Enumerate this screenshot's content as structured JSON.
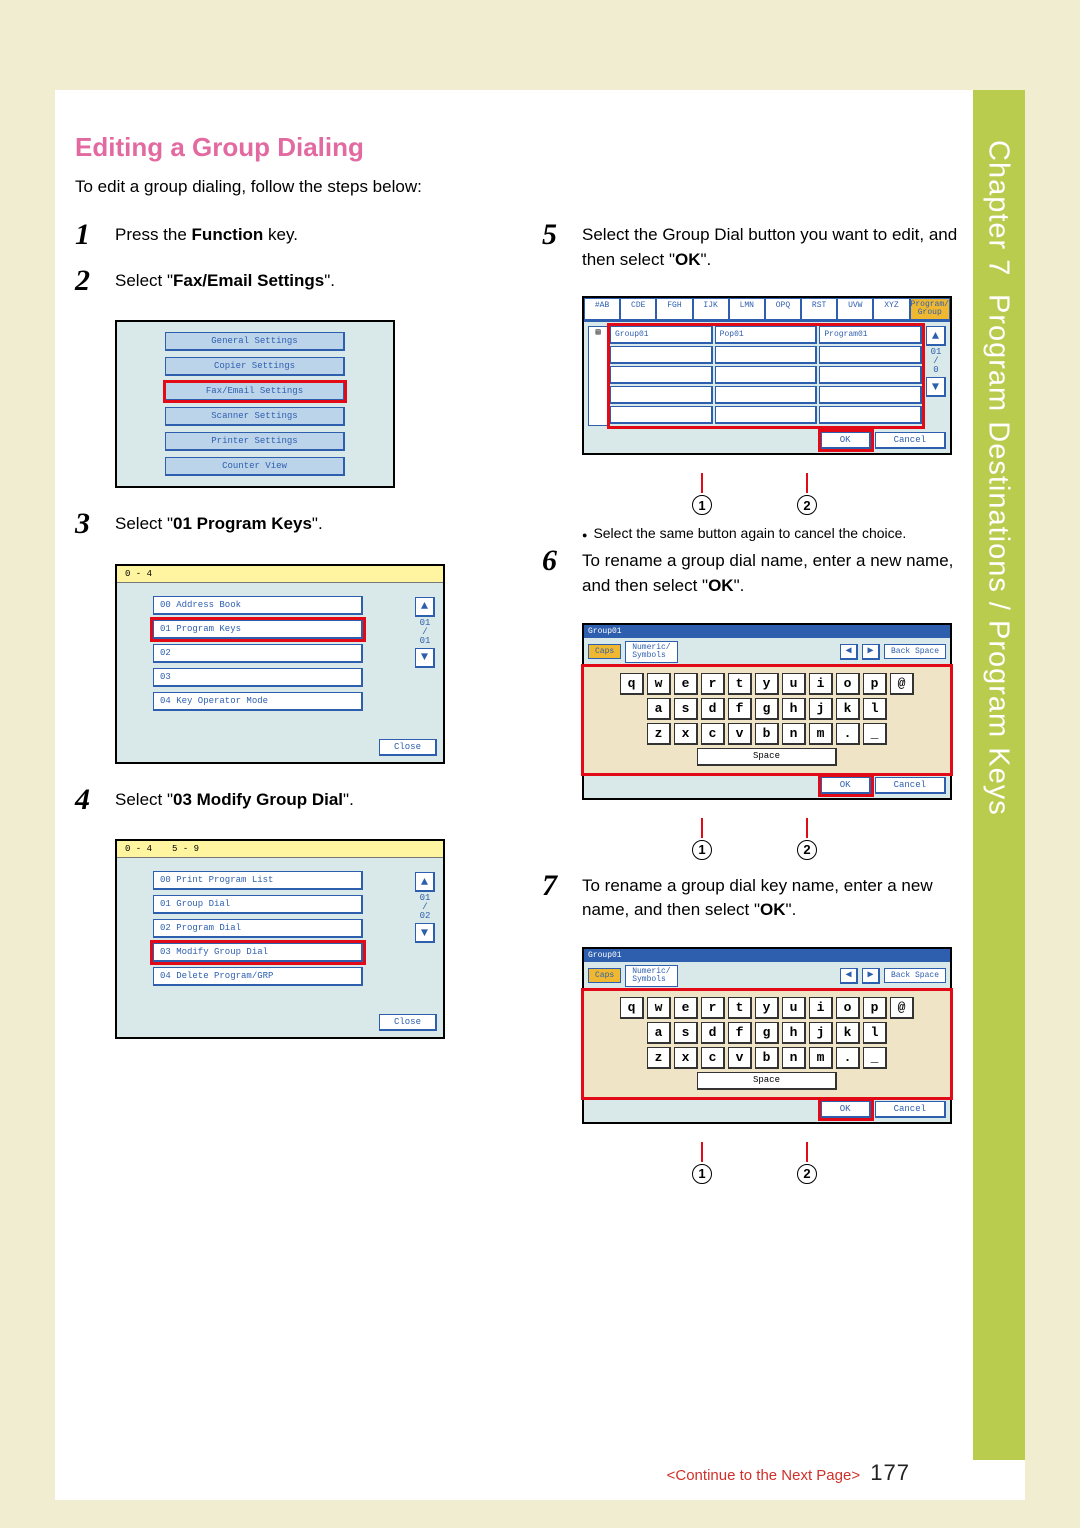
{
  "sidebar": {
    "chapter_label": "Chapter 7",
    "title": "Program Destinations / Program Keys"
  },
  "heading": "Editing a Group Dialing",
  "intro": "To edit a group dialing, follow the steps below:",
  "steps": {
    "s1": {
      "num": "1",
      "text_before": "Press the ",
      "bold": "Function",
      "text_after": " key."
    },
    "s2": {
      "num": "2",
      "text_before": "Select \"",
      "bold": "Fax/Email Settings",
      "text_after": "\"."
    },
    "s3": {
      "num": "3",
      "text_before": "Select \"",
      "bold": "01 Program Keys",
      "text_after": "\"."
    },
    "s4": {
      "num": "4",
      "text_before": "Select \"",
      "bold": "03 Modify Group Dial",
      "text_after": "\"."
    },
    "s5": {
      "num": "5",
      "text": "Select the Group Dial button you want to edit, and then select \"",
      "bold": "OK",
      "text_after": "\"."
    },
    "s5_sub": "Select the same button again to cancel the choice.",
    "s6": {
      "num": "6",
      "text": "To rename a group dial name, enter a new name, and then select \"",
      "bold": "OK",
      "text_after": "\"."
    },
    "s7": {
      "num": "7",
      "text": "To rename a group dial key name, enter a new name, and then select \"",
      "bold": "OK",
      "text_after": "\"."
    }
  },
  "screens": {
    "menu": [
      "General Settings",
      "Copier Settings",
      "Fax/Email Settings",
      "Scanner Settings",
      "Printer Settings",
      "Counter View"
    ],
    "list3": {
      "tabs": [
        "0 - 4"
      ],
      "items": [
        "00  Address Book",
        "01  Program Keys",
        "02",
        "03",
        "04  Key Operator Mode"
      ],
      "counter": "01\n/\n01",
      "close": "Close"
    },
    "list4": {
      "tabs": [
        "0 - 4",
        "5 - 9"
      ],
      "items": [
        "00  Print Program List",
        "01  Group Dial",
        "02  Program Dial",
        "03  Modify Group Dial",
        "04  Delete Program/GRP"
      ],
      "counter": "01\n/\n02",
      "close": "Close"
    },
    "grid5": {
      "alphatabs": [
        "#AB",
        "CDE",
        "FGH",
        "IJK",
        "LMN",
        "OPQ",
        "RST",
        "UVW",
        "XYZ",
        "Program/\nGroup"
      ],
      "row1": [
        "Group01",
        "Pop01",
        "Program01"
      ],
      "ok": "OK",
      "cancel": "Cancel",
      "counter": "01\n/\n0"
    },
    "kb": {
      "title": "Group01",
      "tabs": [
        "Caps",
        "Numeric/\nSymbols"
      ],
      "backspace": "Back Space",
      "rows": [
        [
          "q",
          "w",
          "e",
          "r",
          "t",
          "y",
          "u",
          "i",
          "o",
          "p",
          "@"
        ],
        [
          "a",
          "s",
          "d",
          "f",
          "g",
          "h",
          "j",
          "k",
          "l"
        ],
        [
          "z",
          "x",
          "c",
          "v",
          "b",
          "n",
          "m",
          ".",
          "_"
        ]
      ],
      "space": "Space",
      "ok": "OK",
      "cancel": "Cancel"
    }
  },
  "callouts": {
    "c1": "1",
    "c2": "2"
  },
  "footer": {
    "cont": "<Continue to the Next Page>",
    "page": "177"
  }
}
